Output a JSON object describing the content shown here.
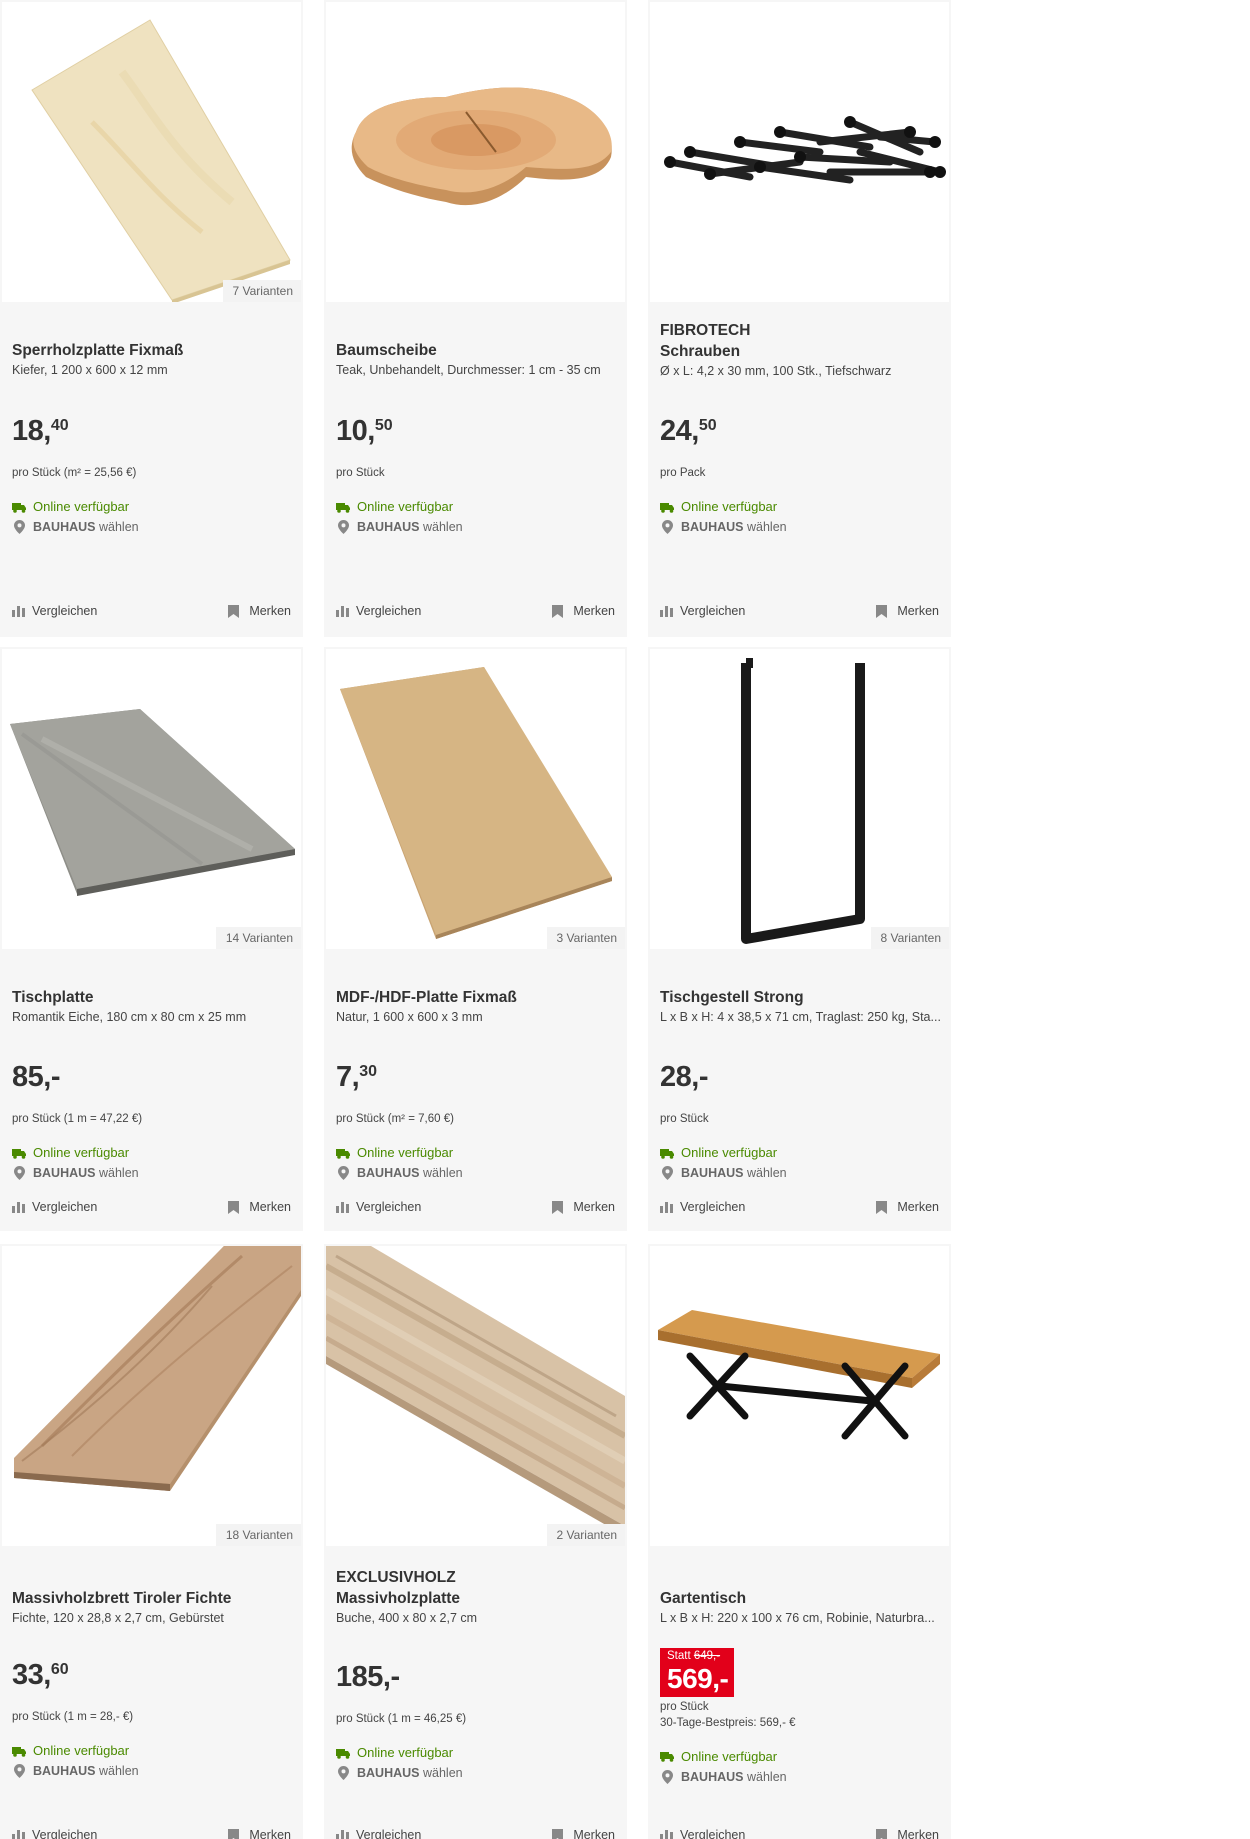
{
  "common": {
    "online": "Online verfügbar",
    "store_brand": "BAUHAUS",
    "store_suffix": "wählen",
    "compare": "Vergleichen",
    "remember": "Merken"
  },
  "products": [
    {
      "brand": "",
      "name": "Sperrholzplatte Fixmaß",
      "desc": "Kiefer, 1 200 x 600 x 12 mm",
      "price_main": "18,",
      "price_cents": "40",
      "unit": "pro Stück (m² = 25,56 €)",
      "variants": "7 Varianten"
    },
    {
      "brand": "",
      "name": "Baumscheibe",
      "desc": "Teak, Unbehandelt, Durchmesser: 1 cm - 35 cm",
      "price_main": "10,",
      "price_cents": "50",
      "unit": "pro Stück",
      "variants": ""
    },
    {
      "brand": "FIBROTECH",
      "name": "Schrauben",
      "desc": "Ø x L: 4,2 x 30 mm, 100 Stk., Tiefschwarz",
      "price_main": "24,",
      "price_cents": "50",
      "unit": "pro Pack",
      "variants": ""
    },
    {
      "brand": "",
      "name": "Tischplatte",
      "desc": "Romantik Eiche, 180 cm x 80 cm x 25 mm",
      "price_main": "85,-",
      "price_cents": "",
      "unit": "pro Stück (1 m = 47,22 €)",
      "variants": "14 Varianten"
    },
    {
      "brand": "",
      "name": "MDF-/HDF-Platte Fixmaß",
      "desc": "Natur, 1 600 x 600 x 3 mm",
      "price_main": "7,",
      "price_cents": "30",
      "unit": "pro Stück (m² = 7,60 €)",
      "variants": "3 Varianten"
    },
    {
      "brand": "",
      "name": "Tischgestell Strong",
      "desc": "L x B x H: 4 x 38,5 x 71 cm, Traglast: 250 kg, Sta...",
      "price_main": "28,-",
      "price_cents": "",
      "unit": "pro Stück",
      "variants": "8 Varianten"
    },
    {
      "brand": "",
      "name": "Massivholzbrett Tiroler Fichte",
      "desc": "Fichte, 120 x 28,8 x 2,7 cm, Gebürstet",
      "price_main": "33,",
      "price_cents": "60",
      "unit": "pro Stück (1 m = 28,- €)",
      "variants": "18 Varianten"
    },
    {
      "brand": "EXCLUSIVHOLZ",
      "name": "Massivholzplatte",
      "desc": "Buche, 400 x 80 x 2,7 cm",
      "price_main": "185,-",
      "price_cents": "",
      "unit": "pro Stück (1 m = 46,25 €)",
      "variants": "2 Varianten"
    },
    {
      "brand": "",
      "name": "Gartentisch",
      "desc": "L x B x H: 220 x 100 x 76 cm, Robinie, Naturbra...",
      "price_main": "",
      "price_cents": "",
      "unit": "pro Stück",
      "variants": "",
      "sale": {
        "statt_label": "Statt",
        "old_price": "649,-",
        "new_price": "569,-",
        "best_price": "30-Tage-Bestpreis: 569,- €"
      }
    }
  ],
  "colors": {
    "online_green": "#4a8a00",
    "sale_red": "#e2001a"
  }
}
